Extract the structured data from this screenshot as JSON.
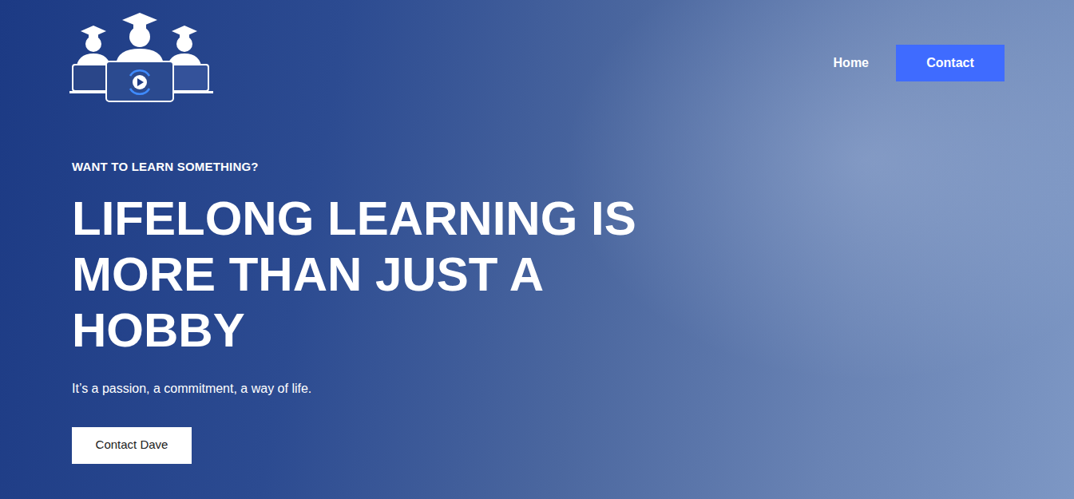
{
  "nav": [
    {
      "label": "Home",
      "kind": "link"
    },
    {
      "label": "Contact",
      "kind": "button"
    }
  ],
  "hero": {
    "eyebrow": "WANT TO LEARN SOMETHING?",
    "title": "LIFELONG LEARNING IS MORE THAN JUST A HOBBY",
    "subtitle": "It’s a passion, a commitment, a way of life.",
    "button": "Contact Dave"
  }
}
